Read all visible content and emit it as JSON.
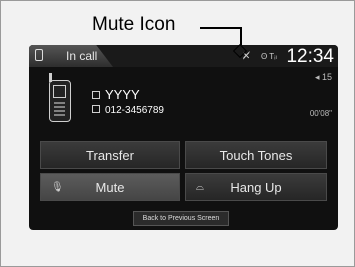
{
  "annotation": {
    "callout_label": "Mute Icon"
  },
  "status_bar": {
    "tab_label": "In call",
    "mute_indicator_icon": "muted-mic-icon",
    "status_icons": "ʘ Tᵢₗ",
    "clock": "12:34",
    "signal": "◂ 15"
  },
  "caller": {
    "name": "YYYY",
    "number": "012-3456789",
    "duration": "00'08\""
  },
  "buttons": {
    "transfer": "Transfer",
    "touch_tones": "Touch Tones",
    "mute": "Mute",
    "hang_up": "Hang Up",
    "back": "Back to Previous Screen"
  }
}
